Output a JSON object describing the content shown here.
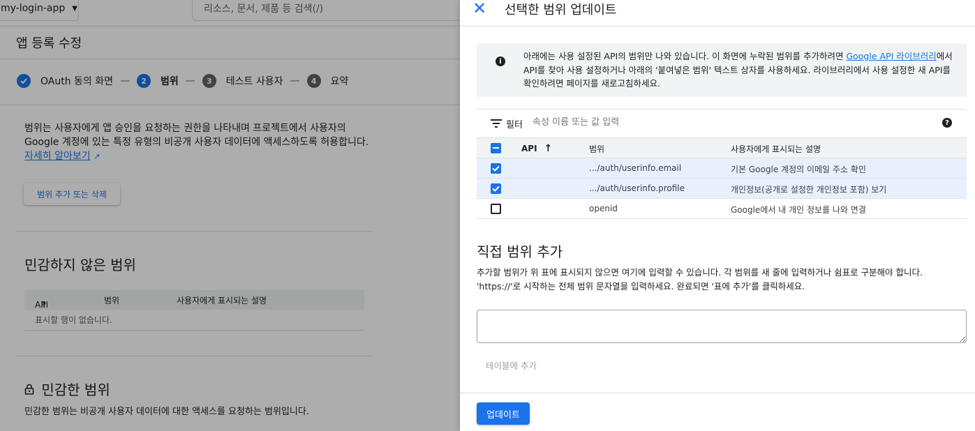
{
  "topbar": {
    "project_name": "my-login-app",
    "search_placeholder": "리소스, 문서, 제품 등 검색(/)"
  },
  "page_title": "앱 등록 수정",
  "stepper": {
    "steps": [
      {
        "number": "1",
        "label": "OAuth 동의 화면",
        "state": "done"
      },
      {
        "number": "2",
        "label": "범위",
        "state": "active"
      },
      {
        "number": "3",
        "label": "테스트 사용자",
        "state": "todo"
      },
      {
        "number": "4",
        "label": "요약",
        "state": "todo"
      }
    ],
    "dash": "—"
  },
  "scopes_page": {
    "description": "범위는 사용자에게 앱 승인을 요청하는 권한을 나타내며 프로젝트에서 사용자의 Google 계정에 있는 특정 유형의 비공개 사용자 데이터에 액세스하도록 허용합니다.",
    "learn_more": "자세히 알아보기",
    "add_remove_button": "범위 추가 또는 삭제",
    "non_sensitive_title": "민감하지 않은 범위",
    "table_headers": {
      "api": "API",
      "scope": "범위",
      "description": "사용자에게 표시되는 설명"
    },
    "empty_text": "표시할 행이 없습니다.",
    "sensitive_title": "민감한 범위",
    "sensitive_desc": "민감한 범위는 비공개 사용자 데이터에 대한 액세스를 요청하는 범위입니다."
  },
  "panel": {
    "title": "선택한 범위 업데이트",
    "info_text": "아래에는 사용 설정된 API의 범위만 나와 있습니다. 이 화면에 누락된 범위를 추가하려면 ",
    "info_link": "Google API 라이브러리",
    "info_text_after": "에서 API를 찾아 사용 설정하거나 아래의 '붙여넣은 범위' 텍스트 상자를 사용하세요. 라이브러리에서 사용 설정한 새 API를 확인하려면 페이지를 새로고침하세요.",
    "filter_label": "필터",
    "filter_placeholder": "속성 이름 또는 값 입력",
    "table": {
      "headers": {
        "api": "API",
        "scope": "범위",
        "description": "사용자에게 표시되는 설명"
      },
      "rows": [
        {
          "checked": true,
          "api": "",
          "scope": ".../auth/userinfo.email",
          "description": "기본 Google 계정의 이메일 주소 확인"
        },
        {
          "checked": true,
          "api": "",
          "scope": ".../auth/userinfo.profile",
          "description": "개인정보(공개로 설정한 개인정보 포함) 보기"
        },
        {
          "checked": false,
          "api": "",
          "scope": "openid",
          "description": "Google에서 내 개인 정보를 나와 연결"
        }
      ]
    },
    "manual_title": "직접 범위 추가",
    "manual_desc": "추가할 범위가 위 표에 표시되지 않으면 여기에 입력할 수 있습니다. 각 범위를 새 줄에 입력하거나 쉼표로 구분해야 합니다. 'https://'로 시작하는 전체 범위 문자열을 입력하세요. 완료되면 '표에 추가'를 클릭하세요.",
    "add_to_table": "테이블에 추가",
    "update_button": "업데이트"
  },
  "colors": {
    "accent": "#1a73e8",
    "selected_row": "#e8f0fe",
    "header_bg": "#f1f3f4"
  }
}
